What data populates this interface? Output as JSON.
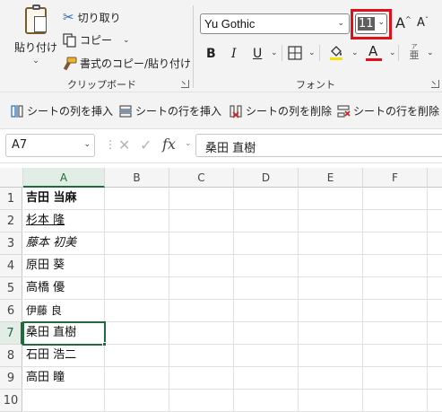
{
  "ribbon": {
    "clipboard": {
      "paste_label": "貼り付け",
      "cut_label": "切り取り",
      "copy_label": "コピー",
      "format_painter_label": "書式のコピー/貼り付け",
      "group_label": "クリップボード"
    },
    "font": {
      "font_name": "Yu Gothic",
      "font_size": "11",
      "grow_label": "A",
      "shrink_label": "A",
      "bold_label": "B",
      "italic_label": "I",
      "underline_label": "U",
      "font_color_label": "A",
      "furigana_top": "ア",
      "furigana_bottom": "亜",
      "group_label": "フォント",
      "font_color": "#e0101a",
      "fill_color": "#f5e10a"
    }
  },
  "cell_toolbar": {
    "insert_col": "シートの列を挿入",
    "insert_row": "シートの行を挿入",
    "delete_col": "シートの列を削除",
    "delete_row": "シートの行を削除"
  },
  "formula_bar": {
    "name_box": "A7",
    "formula_value": "桑田 直樹",
    "fx_label": "fx"
  },
  "sheet": {
    "columns": [
      "A",
      "B",
      "C",
      "D",
      "E",
      "F"
    ],
    "rows": [
      "1",
      "2",
      "3",
      "4",
      "5",
      "6",
      "7",
      "8",
      "9",
      "10"
    ],
    "cells": {
      "a1": "吉田 当麻",
      "a2": "杉本 隆",
      "a3": "藤本 初美",
      "a4": "原田 葵",
      "a5": "高橋 優",
      "a6": "伊藤 良",
      "a7": "桑田 直樹",
      "a8": "石田 浩二",
      "a9": "高田 瞳",
      "a10": ""
    },
    "active_cell": "A7",
    "accent_color": "#1e6b3c"
  }
}
